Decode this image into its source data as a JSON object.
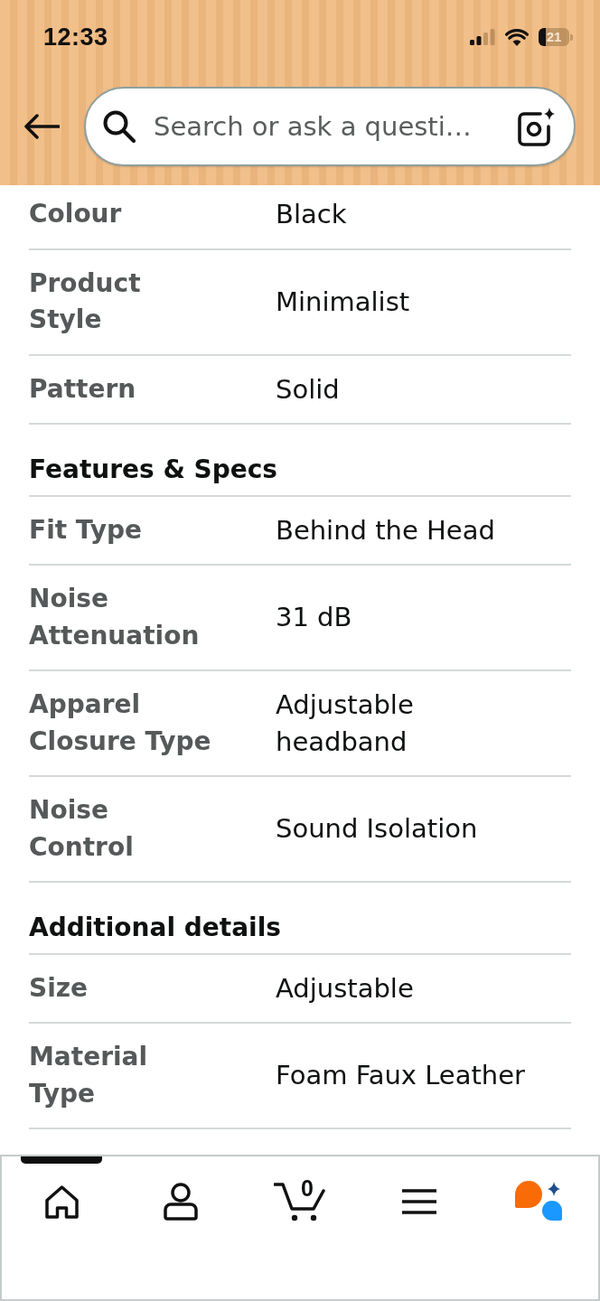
{
  "status_bar": {
    "time": "12:33",
    "battery": "21"
  },
  "header": {
    "search": {
      "placeholder": "Search or ask a questi…"
    }
  },
  "sections": [
    {
      "rows": [
        {
          "label": "Colour",
          "value": "Black"
        },
        {
          "label": "Product Style",
          "value": "Minimalist"
        },
        {
          "label": "Pattern",
          "value": "Solid"
        }
      ]
    },
    {
      "heading": "Features & Specs",
      "rows": [
        {
          "label": "Fit Type",
          "value": "Behind the Head"
        },
        {
          "label": "Noise Attenuation",
          "value": "31 dB"
        },
        {
          "label": "Apparel Closure Type",
          "value": "Adjustable headband"
        },
        {
          "label": "Noise Control",
          "value": "Sound Isolation"
        }
      ]
    },
    {
      "heading": "Additional details",
      "rows": [
        {
          "label": "Size",
          "value": "Adjustable"
        },
        {
          "label": "Material Type",
          "value": "Foam Faux Leather"
        }
      ]
    }
  ],
  "bottom_nav": {
    "items": [
      {
        "kind": "home",
        "selected": true
      },
      {
        "kind": "account",
        "selected": false
      },
      {
        "kind": "cart",
        "count": "0",
        "selected": false
      },
      {
        "kind": "menu",
        "selected": false
      },
      {
        "kind": "assistant",
        "selected": false
      }
    ]
  }
}
